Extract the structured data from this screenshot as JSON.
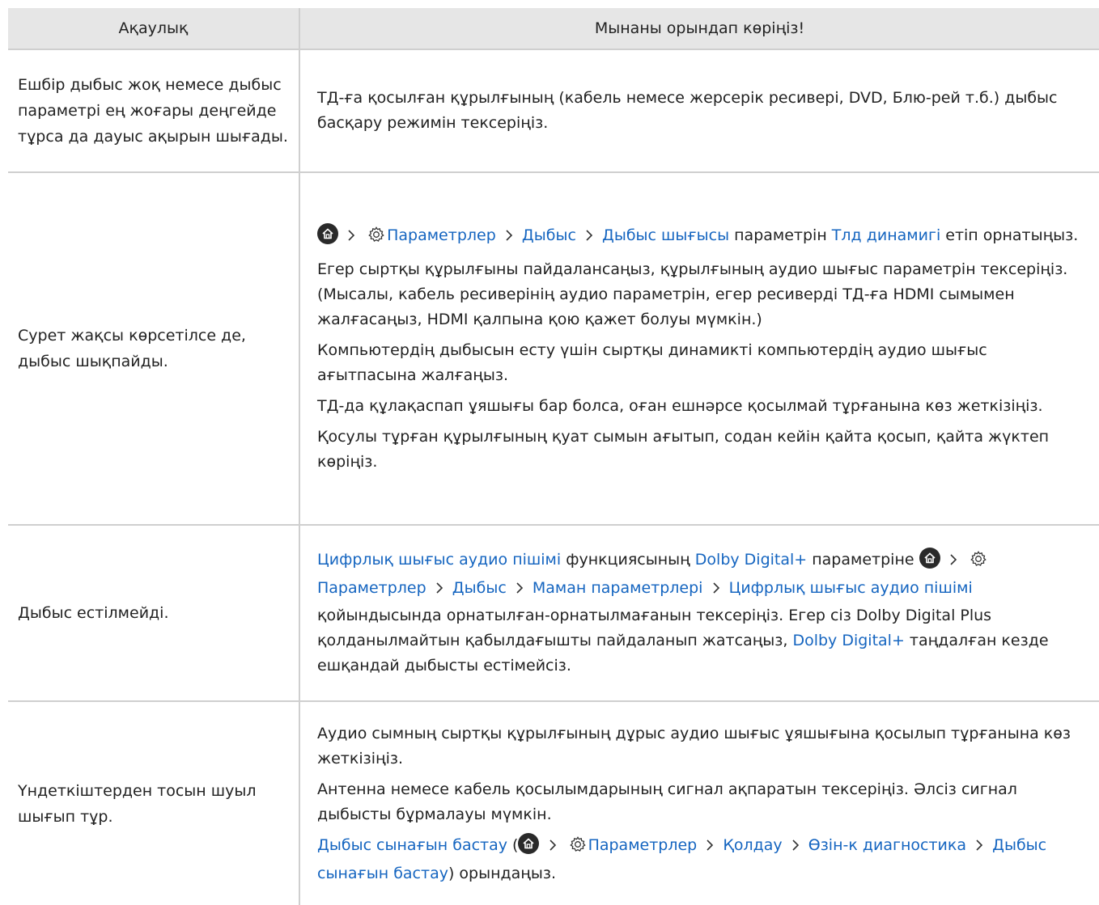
{
  "header": {
    "col1": "Ақаулық",
    "col2": "Мынаны орындап көріңіз!"
  },
  "rows": [
    {
      "problem": "Ешбір дыбыс жоқ немесе дыбыс параметрі ең жоғары деңгейде тұрса да дауыс ақырын шығады.",
      "p1": "ТД-ға қосылған құрылғының (кабель немесе жерсерік ресивері, DVD, Блю-рей т.б.) дыбыс басқару режимін тексеріңіз."
    },
    {
      "problem": "Сурет жақсы көрсетілсе де, дыбыс шықпайды.",
      "settings": "Параметрлер",
      "sound": "Дыбыс",
      "sound_output": "Дыбыс шығысы",
      "p1_mid": " параметрін ",
      "tv_speaker": "Тлд динамигі",
      "p1_end": " етіп орнатыңыз.",
      "p2": "Егер сыртқы құрылғыны пайдалансаңыз, құрылғының аудио шығыс параметрін тексеріңіз. (Мысалы, кабель ресиверінің аудио параметрін, егер ресиверді ТД-ға HDMI сымымен жалғасаңыз, HDMI қалпына қою қажет болуы мүмкін.)",
      "p3": "Компьютердің дыбысын есту үшін сыртқы динамикті компьютердің аудио шығыс ағытпасына жалғаңыз.",
      "p4": "ТД-да құлақаспап ұяшығы бар болса, оған ешнәрсе қосылмай тұрғанына көз жеткізіңіз.",
      "p5": "Қосулы тұрған құрылғының қуат сымын ағытып, содан кейін қайта қосып, қайта жүктеп көріңіз."
    },
    {
      "problem": "Дыбыс естілмейді.",
      "digital_format": "Цифрлық шығыс аудио пішімі",
      "t1": " функциясының ",
      "dolby": "Dolby Digital+",
      "t2": " параметріне ",
      "settings": "Параметрлер",
      "sound": "Дыбыс",
      "expert": "Маман параметрлері",
      "digital_format2": "Цифрлық шығыс аудио пішімі",
      "t3": " қойындысында орнатылған-орнатылмағанын тексеріңіз. Егер сіз Dolby Digital Plus қолданылмайтын қабылдағышты пайдаланып жатсаңыз, ",
      "dolby2": "Dolby Digital+",
      "t4": " таңдалған кезде ешқандай дыбысты естімейсіз."
    },
    {
      "problem": "Үндеткіштерден тосын шуыл шығып тұр.",
      "p1": "Аудио сымның сыртқы құрылғының дұрыс аудио шығыс ұяшығына қосылып тұрғанына көз жеткізіңіз.",
      "p2": "Антенна немесе кабель қосылымдарының сигнал ақпаратын тексеріңіз. Әлсіз сигнал дыбысты бұрмалауы мүмкін.",
      "sound_test": "Дыбыс сынағын бастау",
      "open_paren": " (",
      "settings": "Параметрлер",
      "support": "Қолдау",
      "self_diag": "Өзін-к диагностика",
      "sound_test2": "Дыбыс сынағын бастау",
      "t_end": ") орындаңыз."
    }
  ]
}
